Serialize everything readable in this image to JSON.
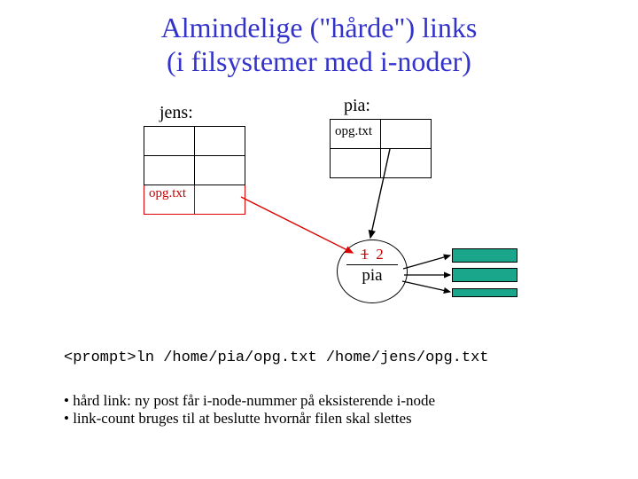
{
  "title_line1": "Almindelige (\"hårde\") links",
  "title_line2": "(i filsystemer med i-noder)",
  "labels": {
    "jens": "jens:",
    "pia": "pia:"
  },
  "cells": {
    "jens_opg": "opg.txt",
    "pia_opg": "opg.txt"
  },
  "inode": {
    "count_old": "1",
    "count_new": "2",
    "name": "pia"
  },
  "command": {
    "prompt": "<prompt>",
    "text": "ln /home/pia/opg.txt /home/jens/opg.txt"
  },
  "bullets": [
    "hård link: ny post får i-node-nummer på eksisterende i-node",
    "link-count bruges til at beslutte hvornår filen skal slettes"
  ]
}
